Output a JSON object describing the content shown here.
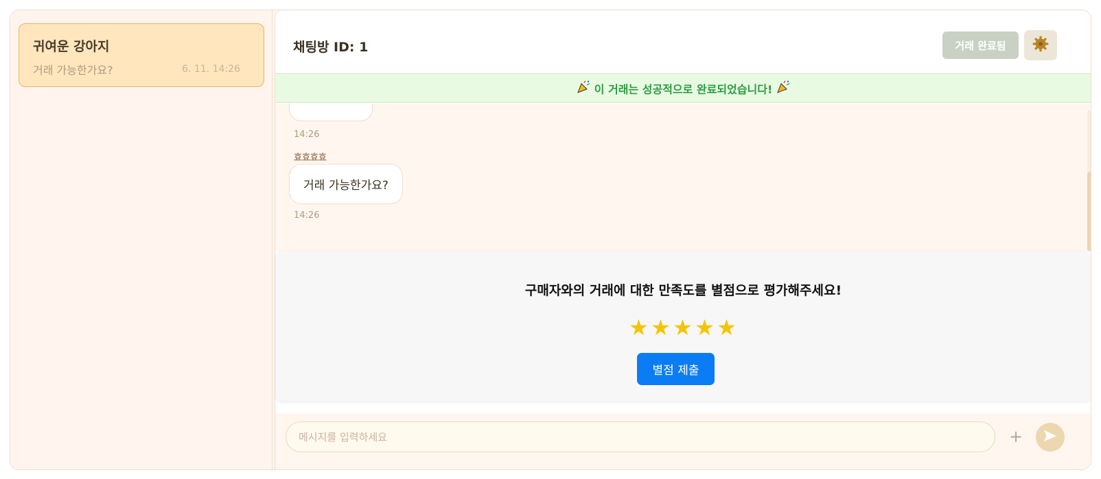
{
  "sidebar": {
    "rooms": [
      {
        "name": "귀여운 강아지",
        "last_message": "거래 가능한가요?",
        "time": "6. 11. 14:26"
      }
    ]
  },
  "header": {
    "title": "채팅방 ID: 1",
    "done_label": "거래 완료됨",
    "settings_icon": "gear-icon"
  },
  "banner": {
    "icon": "party-popper-icon",
    "text": "이 거래는 성공적으로 완료되었습니다!"
  },
  "messages": [
    {
      "sender": "",
      "text": "",
      "time": "14:26"
    },
    {
      "sender": "효효효효",
      "text": "거래 가능한가요?",
      "time": "14:26"
    }
  ],
  "rating": {
    "question": "구매자와의 거래에 대한 만족도를 별점으로 평가해주세요!",
    "stars_filled": 5,
    "stars_total": 5,
    "submit_label": "별점 제출"
  },
  "input": {
    "placeholder": "메시지를 입력하세요",
    "plus_label": "+",
    "send_icon": "send-icon"
  },
  "colors": {
    "accent": "#0a7cf4",
    "banner_text": "#2f9a45",
    "star": "#f5c400"
  }
}
